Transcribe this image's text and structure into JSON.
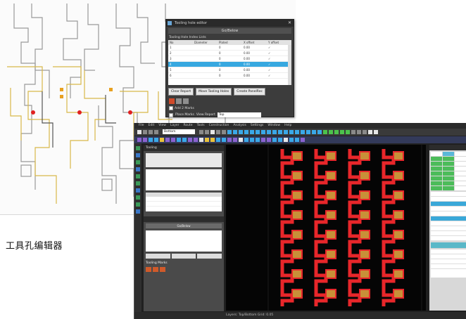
{
  "caption": "工具孔编辑器",
  "dialog": {
    "title": "Tooling hole editor",
    "subtitle": "Go/Below",
    "caption_line": "Tooling Hole Index Lists",
    "columns": [
      "No",
      "Diameter",
      "Plated",
      "X offset",
      "Y offset"
    ],
    "rows": [
      [
        "1",
        "",
        "0",
        "0.00",
        "✓"
      ],
      [
        "2",
        "",
        "0",
        "0.00",
        "✓"
      ],
      [
        "3",
        "",
        "0",
        "0.00",
        "✓"
      ],
      [
        "4",
        "",
        "0",
        "0.00",
        "✓"
      ],
      [
        "5",
        "",
        "0",
        "0.00",
        "✓"
      ],
      [
        "6",
        "",
        "0",
        "0.00",
        "✓"
      ]
    ],
    "selected_row": 3,
    "buttons": {
      "clear_report": "Clear Report",
      "move_tooling": "Move Tooling Holes",
      "create_panel": "Create PanelRec"
    },
    "checkbox_label": "Add 2 Marks",
    "bottom_label_1": "Place Marks",
    "bottom_label_2": "View Report",
    "bottom_field": "Top"
  },
  "app": {
    "menu": [
      "File",
      "Edit",
      "View",
      "Layer",
      "Route",
      "Tools",
      "Construction",
      "Analysis",
      "Settings",
      "Window",
      "Help"
    ],
    "layer_select": "Bottom",
    "left_panel": {
      "title": "Tooling",
      "sub_title": "Go/Below",
      "label": "Tooling Marks"
    },
    "status_text": "Layers: Top/Bottom  Grid: 0.05"
  },
  "colors": {
    "trace_red": "#e8262a",
    "pad_orange": "#c89038",
    "schematic_yellow": "#d8b84a",
    "schematic_gray": "#9a9a9a",
    "highlight_blue": "#37a8e0"
  }
}
